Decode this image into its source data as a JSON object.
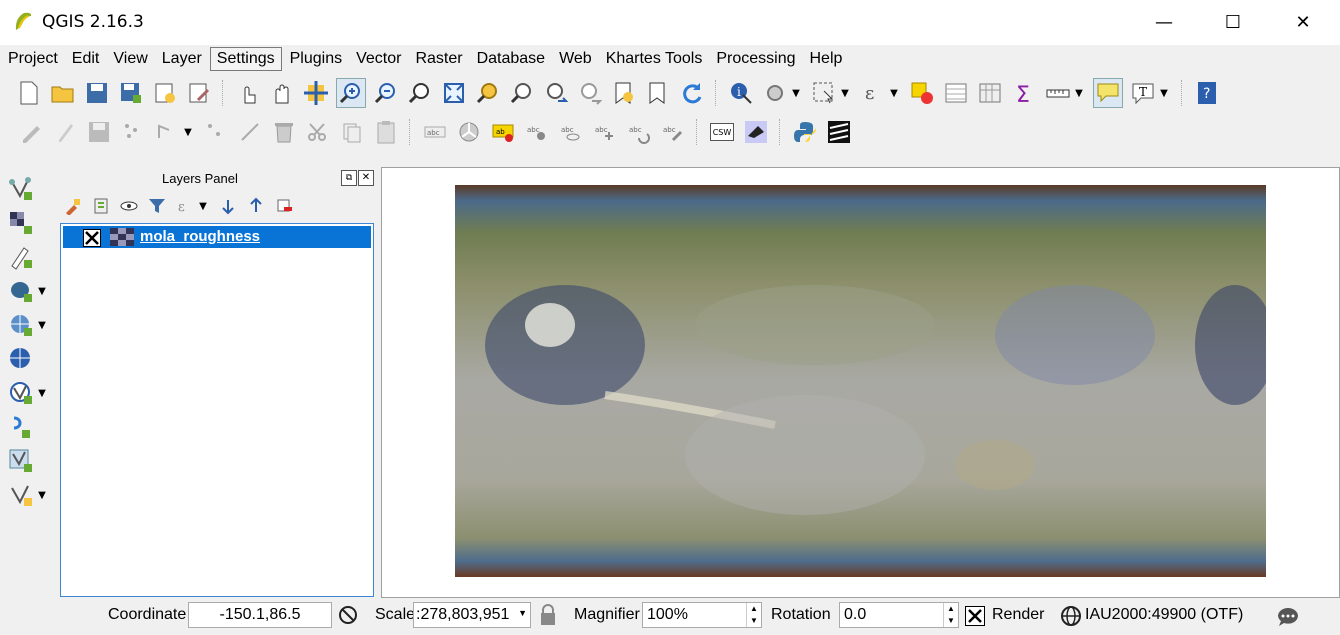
{
  "window": {
    "title": "QGIS 2.16.3",
    "minimize": "—",
    "maximize": "☐",
    "close": "✕"
  },
  "menubar": {
    "items": [
      "Project",
      "Edit",
      "View",
      "Layer",
      "Settings",
      "Plugins",
      "Vector",
      "Raster",
      "Database",
      "Web",
      "Khartes Tools",
      "Processing",
      "Help"
    ],
    "selected": "Settings"
  },
  "layers_panel": {
    "title": "Layers Panel",
    "layers": [
      {
        "name": "mola_roughness",
        "checked": true
      }
    ]
  },
  "statusbar": {
    "coordinate_label": "Coordinate",
    "coordinate_value": "-150.1,86.5",
    "scale_label": "Scale",
    "scale_value": ":278,803,951",
    "magnifier_label": "Magnifier",
    "magnifier_value": "100%",
    "rotation_label": "Rotation",
    "rotation_value": "0.0",
    "render_label": "Render",
    "render_checked": true,
    "crs": "IAU2000:49900 (OTF)"
  },
  "toolbar2_labels": {
    "csw": "CSW"
  },
  "colors": {
    "selection": "#0a74d6",
    "accent": "#3d86d4"
  }
}
